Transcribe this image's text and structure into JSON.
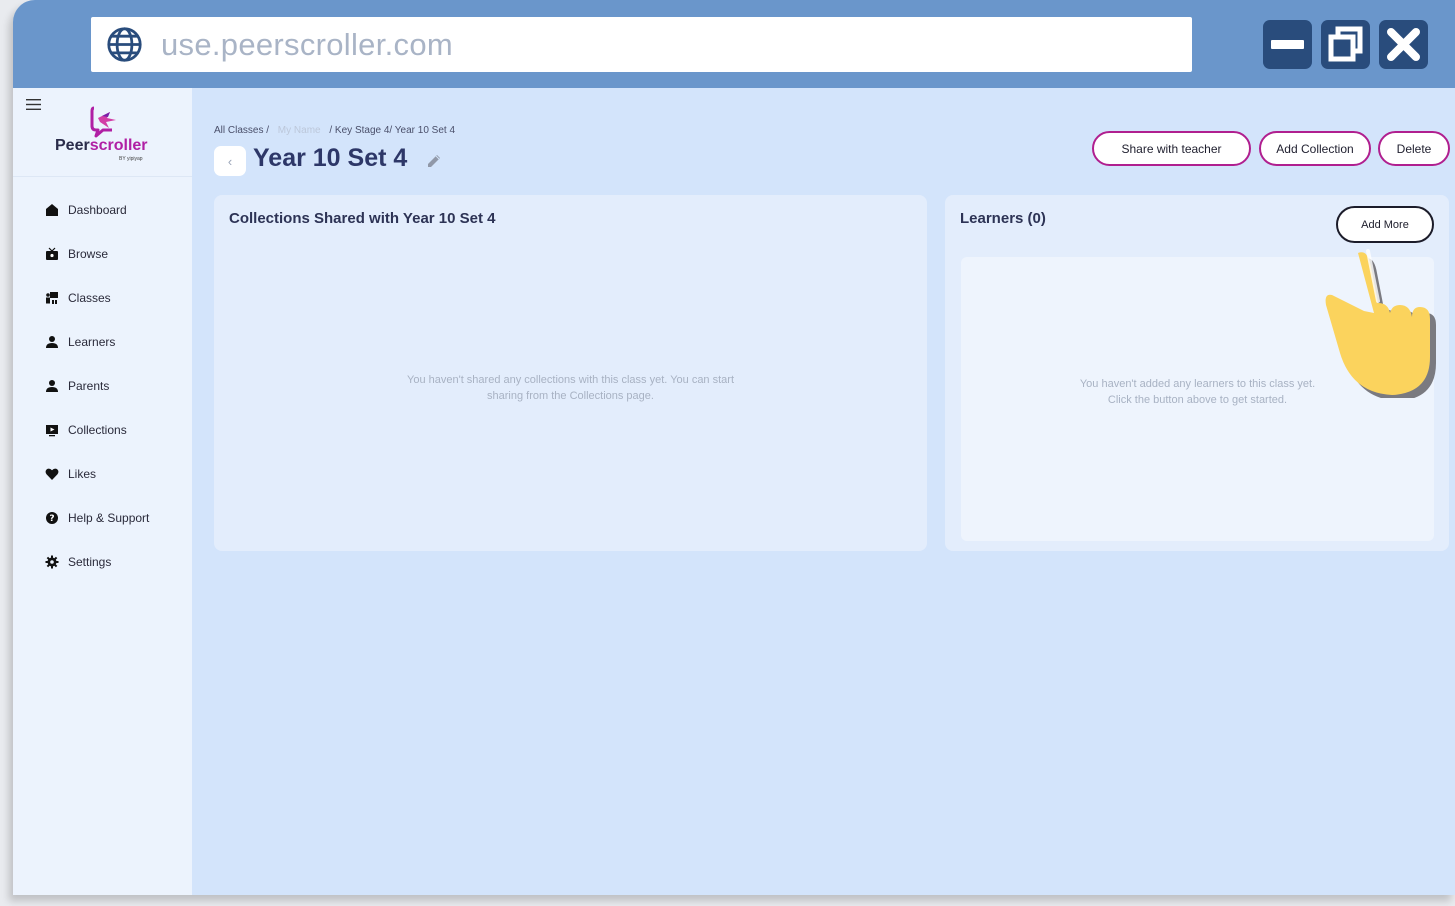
{
  "browser": {
    "url": "use.peerscroller.com"
  },
  "colors": {
    "chrome": "#6a96cb",
    "window_button": "#294c7c",
    "accent": "#b01f8f",
    "page_bg": "#d3e4fb",
    "sidebar_bg": "#ecf3fd"
  },
  "logo": {
    "name_part1": "Peer",
    "name_part2": "scroller",
    "byline": "BY yipiyap"
  },
  "sidebar": {
    "items": [
      {
        "label": "Dashboard",
        "icon": "home-icon"
      },
      {
        "label": "Browse",
        "icon": "tv-icon"
      },
      {
        "label": "Classes",
        "icon": "classroom-icon"
      },
      {
        "label": "Learners",
        "icon": "person-icon"
      },
      {
        "label": "Parents",
        "icon": "person-icon"
      },
      {
        "label": "Collections",
        "icon": "monitor-play-icon"
      },
      {
        "label": "Likes",
        "icon": "heart-icon"
      },
      {
        "label": "Help & Support",
        "icon": "question-icon"
      },
      {
        "label": "Settings",
        "icon": "gear-icon"
      }
    ]
  },
  "breadcrumb": {
    "all_classes": "All Classes /",
    "my_name": "My Name",
    "rest": "/ Key Stage 4/ Year 10 Set 4"
  },
  "page": {
    "title": "Year 10 Set 4"
  },
  "actions": {
    "share": "Share with teacher",
    "add_collection": "Add Collection",
    "delete": "Delete"
  },
  "collections_card": {
    "title": "Collections Shared with Year 10 Set 4",
    "empty_line1": "You haven't shared any collections with this class yet. You can start",
    "empty_line2": "sharing from the Collections page."
  },
  "learners_card": {
    "title": "Learners (0)",
    "add_more": "Add More",
    "empty_line1": "You haven't added any learners to this class yet.",
    "empty_line2": "Click the button above to get started."
  }
}
